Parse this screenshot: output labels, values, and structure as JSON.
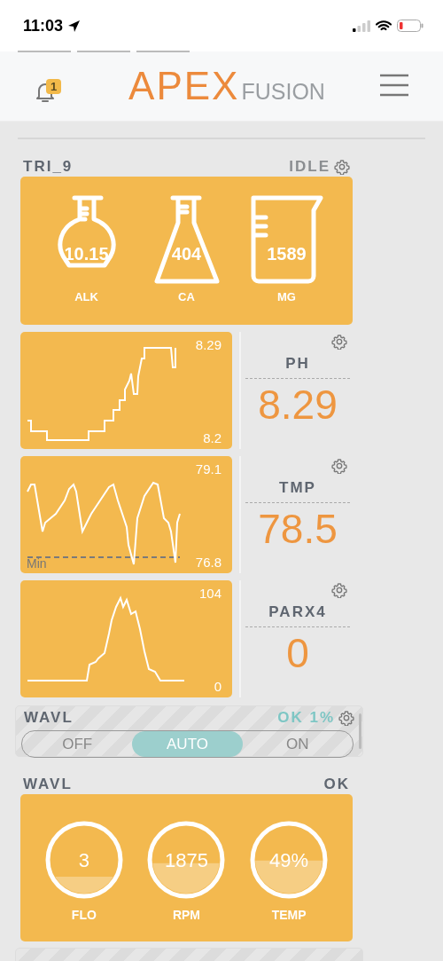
{
  "status_bar": {
    "time": "11:03"
  },
  "header": {
    "notification_count": "1",
    "logo_main": "APEX",
    "logo_sub": "FUSION"
  },
  "trident": {
    "name": "TRI_9",
    "status": "IDLE",
    "readings": [
      {
        "kind": "round-flask",
        "value": "10.15",
        "label": "ALK"
      },
      {
        "kind": "conical-flask",
        "value": "404",
        "label": "CA"
      },
      {
        "kind": "beaker",
        "value": "1589",
        "label": "MG"
      }
    ]
  },
  "probes": [
    {
      "name": "PH",
      "value": "8.29",
      "max": "8.29",
      "min": "8.2"
    },
    {
      "name": "TMP",
      "value": "78.5",
      "max": "79.1",
      "min": "76.8",
      "min_line_label": "Min"
    },
    {
      "name": "PARX4",
      "value": "0",
      "max": "104",
      "min": "0"
    }
  ],
  "outlet": {
    "name": "WAVL",
    "status": "OK 1%",
    "options": [
      {
        "label": "OFF",
        "selected": false
      },
      {
        "label": "AUTO",
        "selected": true
      },
      {
        "label": "ON",
        "selected": false
      }
    ]
  },
  "pump": {
    "name": "WAVL",
    "status": "OK",
    "gauges": [
      {
        "value": "3",
        "label": "FLO"
      },
      {
        "value": "1875",
        "label": "RPM"
      },
      {
        "value": "49%",
        "label": "TEMP"
      }
    ]
  }
}
